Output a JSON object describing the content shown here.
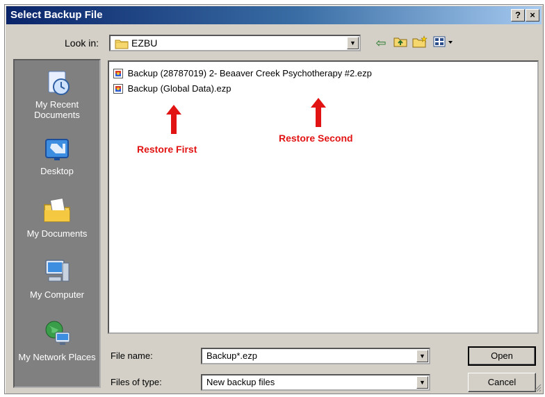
{
  "window": {
    "title": "Select Backup File",
    "help_label": "?",
    "close_label": "×"
  },
  "lookin": {
    "label": "Look in:",
    "value": "EZBU"
  },
  "places": [
    {
      "label": "My Recent Documents",
      "icon": "recent-documents-icon"
    },
    {
      "label": "Desktop",
      "icon": "desktop-icon"
    },
    {
      "label": "My Documents",
      "icon": "my-documents-icon"
    },
    {
      "label": "My Computer",
      "icon": "my-computer-icon"
    },
    {
      "label": "My Network Places",
      "icon": "network-places-icon"
    }
  ],
  "files": [
    {
      "name": "Backup (28787019) 2- Beaaver Creek Psychotherapy #2.ezp"
    },
    {
      "name": "Backup (Global Data).ezp"
    }
  ],
  "annotations": {
    "restore_first": "Restore First",
    "restore_second": "Restore Second",
    "color": "#e21313"
  },
  "filename": {
    "label": "File name:",
    "value": "Backup*.ezp"
  },
  "filetype": {
    "label": "Files of type:",
    "value": "New backup files"
  },
  "buttons": {
    "open": "Open",
    "cancel": "Cancel"
  },
  "colors": {
    "title_start": "#0a246a",
    "title_end": "#a6caf0",
    "dialog_bg": "#d4d0c8",
    "places_bg": "#808080"
  }
}
